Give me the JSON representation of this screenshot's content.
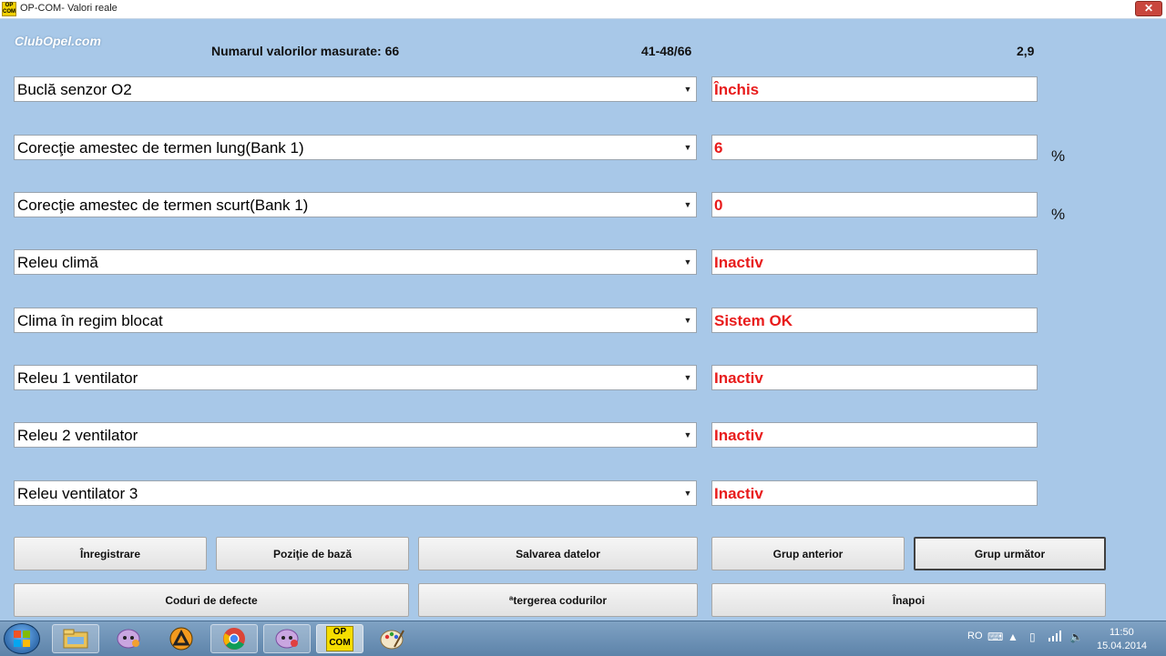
{
  "window": {
    "title": "OP-COM- Valori reale",
    "app_icon_text_top": "OP",
    "app_icon_text_bottom": "COM",
    "close_label": "✕"
  },
  "logo": "ClubOpel.com",
  "header": {
    "count_label": "Numarul valorilor masurate: 66",
    "range": "41-48/66",
    "value": "2,9"
  },
  "rows": [
    {
      "param": "Buclă senzor O2",
      "value": "Închis",
      "unit": ""
    },
    {
      "param": "Corecţie amestec de termen lung(Bank 1)",
      "value": "6",
      "unit": "%"
    },
    {
      "param": "Corecţie amestec de termen scurt(Bank 1)",
      "value": "0",
      "unit": "%"
    },
    {
      "param": "Releu climă",
      "value": "Inactiv",
      "unit": ""
    },
    {
      "param": "Clima în regim blocat",
      "value": "Sistem OK",
      "unit": ""
    },
    {
      "param": "Releu 1 ventilator",
      "value": "Inactiv",
      "unit": ""
    },
    {
      "param": "Releu 2 ventilator",
      "value": "Inactiv",
      "unit": ""
    },
    {
      "param": "Releu ventilator 3",
      "value": "Inactiv",
      "unit": ""
    }
  ],
  "buttons": {
    "record": "Înregistrare",
    "base_position": "Poziţie de bază",
    "save_data": "Salvarea datelor",
    "prev_group": "Grup anterior",
    "next_group": "Grup următor",
    "fault_codes": "Coduri de defecte",
    "clear_codes": "ªtergerea codurilor",
    "back": "Înapoi"
  },
  "taskbar": {
    "opcom_top": "OP",
    "opcom_bottom": "COM",
    "language": "RO",
    "time": "11:50",
    "date": "15.04.2014"
  },
  "colors": {
    "background": "#a8c8e8",
    "value_text": "#e81b1b"
  }
}
